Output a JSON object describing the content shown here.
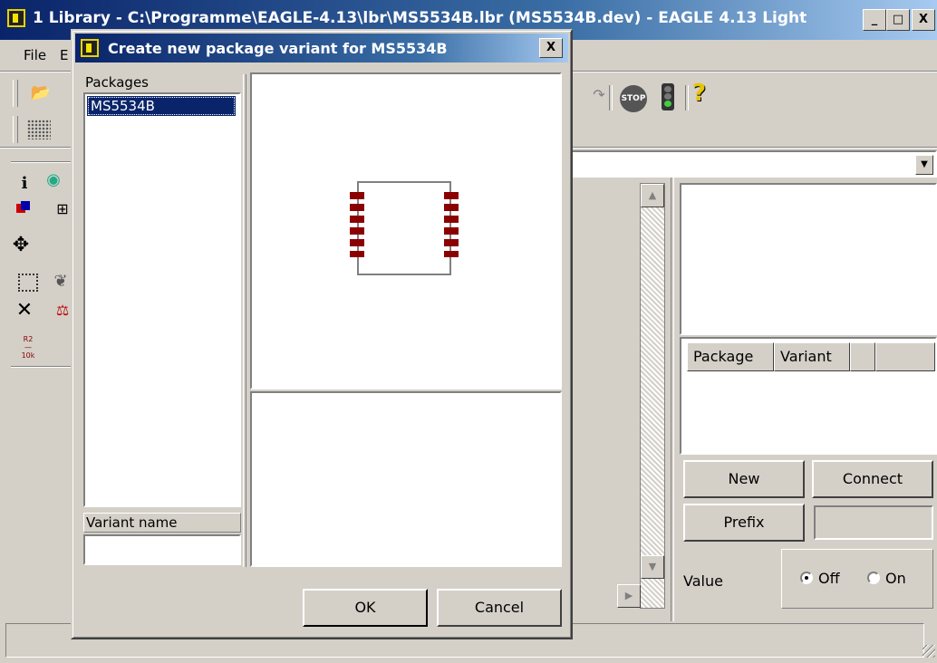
{
  "window": {
    "title": "1 Library - C:\\Programme\\EAGLE-4.13\\lbr\\MS5534B.lbr (MS5534B.dev) - EAGLE 4.13 Light",
    "buttons": {
      "minimize": "_",
      "maximize": "□",
      "close": "X"
    }
  },
  "menu": {
    "file": "File",
    "edit": "E"
  },
  "toolbar": {
    "help_icon": "?",
    "stop_label": "STOP"
  },
  "right_panel": {
    "table_headers": [
      "Package",
      "Variant",
      "",
      ""
    ],
    "new_button": "New",
    "connect_button": "Connect",
    "prefix_button": "Prefix",
    "prefix_value": "",
    "value_label": "Value",
    "value_off": "Off",
    "value_on": "On",
    "value_selected": "Off"
  },
  "dialog": {
    "title": "Create new package variant for MS5534B",
    "close": "X",
    "packages_label": "Packages",
    "packages": [
      "MS5534B"
    ],
    "selected_package": "MS5534B",
    "variant_name_label": "Variant name",
    "variant_name_value": "",
    "ok_button": "OK",
    "cancel_button": "Cancel"
  },
  "colors": {
    "face": "#d4d0c8",
    "title_start": "#0a246a",
    "title_end": "#a6caf0",
    "pad": "#8b0000",
    "outline": "#808080"
  }
}
